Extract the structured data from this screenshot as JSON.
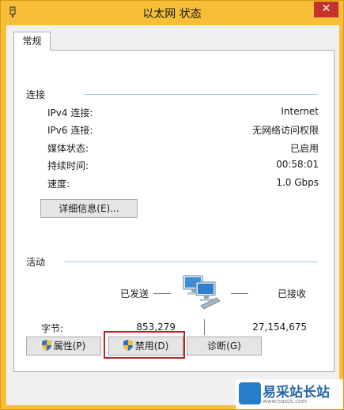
{
  "window": {
    "title": "以太网 状态",
    "close_glyph": "✕"
  },
  "tabs": [
    {
      "label": "常规"
    }
  ],
  "connection": {
    "section_label": "连接",
    "rows": [
      {
        "label": "IPv4 连接:",
        "value": "Internet"
      },
      {
        "label": "IPv6 连接:",
        "value": "无网络访问权限"
      },
      {
        "label": "媒体状态:",
        "value": "已启用"
      },
      {
        "label": "持续时间:",
        "value": "00:58:01"
      },
      {
        "label": "速度:",
        "value": "1.0 Gbps"
      }
    ],
    "details_button": "详细信息(E)..."
  },
  "activity": {
    "section_label": "活动",
    "sent_label": "已发送",
    "received_label": "已接收",
    "bytes_label": "字节:",
    "bytes_sent": "853,279",
    "bytes_received": "27,154,675"
  },
  "buttons": {
    "properties": "属性(P)",
    "disable": "禁用(D)",
    "diagnose": "诊断(G)"
  },
  "watermark": {
    "text": "易采站长站",
    "sub": "www.easck.com"
  },
  "colors": {
    "title_bar": "#f6bf37",
    "close_button": "#c7312c",
    "highlight": "#b0252a",
    "section_line": "#a7c8e0"
  }
}
